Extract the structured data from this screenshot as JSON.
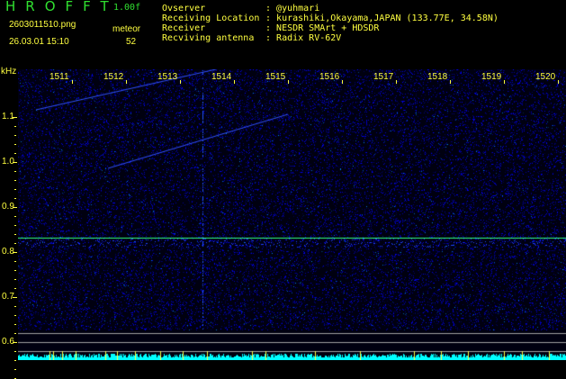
{
  "header": {
    "logo": "HROFFT",
    "version": "1.00f",
    "filename": "2603011510.png",
    "datetime": "26.03.01 15:10",
    "meteor_label": "meteor",
    "meteor_count": "52",
    "info": [
      {
        "label": "Ovserver",
        "value": "@yuhmari"
      },
      {
        "label": "Receiving Location",
        "value": "kurashiki,Okayama,JAPAN (133.77E, 34.58N)"
      },
      {
        "label": "Receiver",
        "value": "NESDR SMArt + HDSDR"
      },
      {
        "label": "Recviving antenna",
        "value": "Radix RV-62V"
      }
    ]
  },
  "axis": {
    "y_unit": "kHz",
    "y_ticks": [
      "1.1",
      "1.0",
      "0.9",
      "0.8",
      "0.7",
      "0.6"
    ],
    "x_ticks": [
      "1511",
      "1512",
      "1513",
      "1514",
      "1515",
      "1516",
      "1517",
      "1518",
      "1519",
      "1520"
    ]
  },
  "colors": {
    "text": "#ffff40",
    "logo": "#30e030",
    "background_noise": "#0010a0",
    "signal": "#40ff80",
    "histogram": "#00ffff"
  }
}
